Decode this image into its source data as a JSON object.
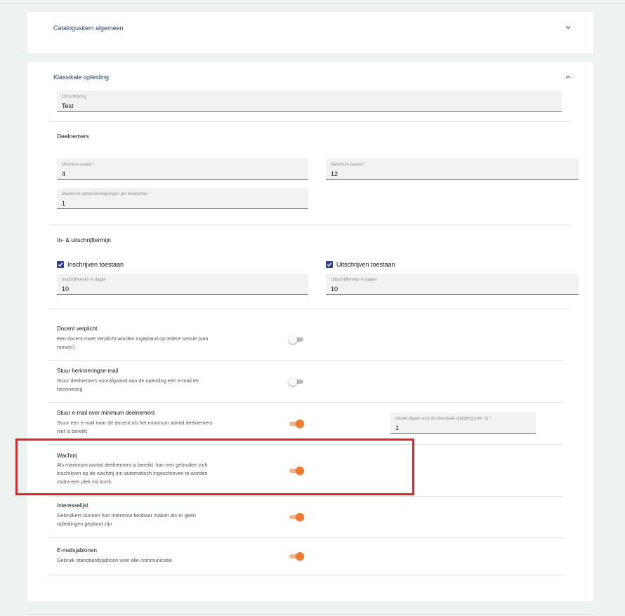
{
  "panels": {
    "general": {
      "title": "Catalogusitem algemeen",
      "chevron_icon": "chevron-down-icon"
    },
    "classroom": {
      "title": "Klassikale opleiding",
      "chevron_icon": "chevron-up-icon"
    }
  },
  "description": {
    "label": "Omschrijving",
    "value": "Test"
  },
  "participants": {
    "heading": "Deelnemers",
    "min": {
      "label": "Minimum aantal *",
      "value": "4"
    },
    "max": {
      "label": "Maximum aantal *",
      "value": "12"
    },
    "max_per": {
      "label": "Maximum aantal inschrijvingen per deelnemer",
      "value": "1"
    }
  },
  "terms": {
    "heading": "In- & uitschrijftermijn",
    "enroll_checkbox": {
      "label": "Inschrijven toestaan",
      "checked": true
    },
    "unenroll_checkbox": {
      "label": "Uitschrijven toestaan",
      "checked": true
    },
    "enroll_days": {
      "label": "Inschrijftermijn in dagen",
      "value": "10"
    },
    "unenroll_days": {
      "label": "Uitschrijftermijn in dagen",
      "value": "10"
    }
  },
  "options": [
    {
      "title": "Docent verplicht",
      "description": "Een docent moet verplicht worden ingepland op iedere sessie (van rooster)",
      "enabled": false
    },
    {
      "title": "Stuur herinneringse-mail",
      "description": "Stuur deelnemers voorafgaand aan de opleiding een e-mail ter herinnering",
      "enabled": false
    },
    {
      "title": "Stuur e-mail over minimum deelnemers",
      "description": "Stuur een e-mail naar de docent als het minimum aantal deelnemers niet is bereikt",
      "enabled": true
    },
    {
      "title": "Wachtrij",
      "description": "Als maximum aantal deelnemers is bereikt, kan een gebruiker zich inschrijven op de wachtrij om automatisch ingeschreven te worden zodra een plek vrij komt.",
      "enabled": true
    },
    {
      "title": "Interesselijst",
      "description": "Gebruikers kunnen hun interesse kenbaar maken als er geen opleidingen gepland zijn",
      "enabled": true
    },
    {
      "title": "E-mailsjablonen",
      "description": "Gebruik standaardsjabloon voor alle communicatie",
      "enabled": true
    }
  ],
  "min_days_field": {
    "label": "Aantal dagen voor de klassikale opleiding (min. 1) *",
    "value": "1"
  },
  "colors": {
    "accent": "#ef7a30",
    "checkbox": "#33418f",
    "highlight": "#e0242a",
    "title": "#1f3e66"
  }
}
